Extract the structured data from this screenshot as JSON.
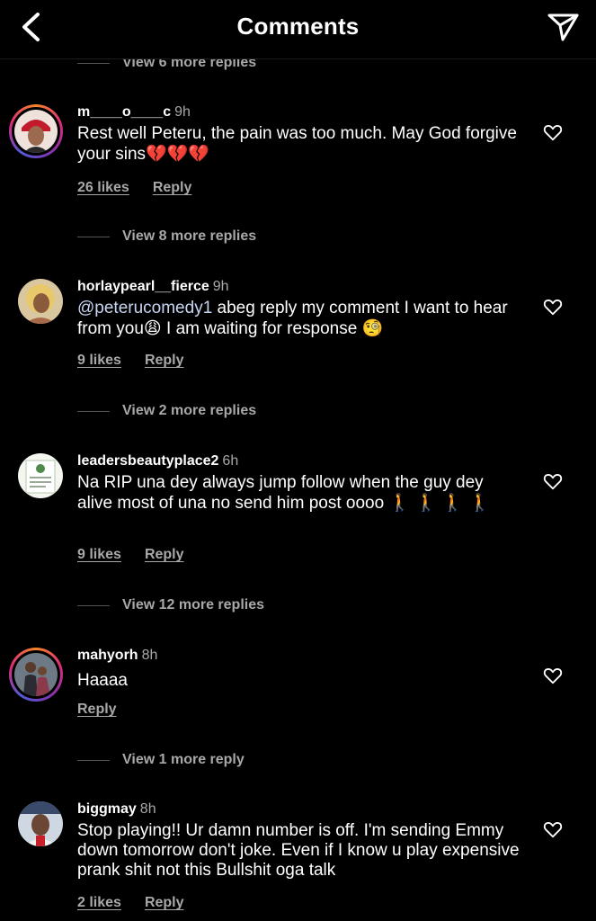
{
  "header": {
    "title": "Comments",
    "back_icon": "chevron-left-icon",
    "share_icon": "paper-plane-icon"
  },
  "view_more_top": "View 6 more replies",
  "comments": [
    {
      "username": "m____o____c",
      "time": "9h",
      "text": "Rest well Peteru, the pain was too much. May God forgive your sins",
      "emojis": "💔💔💔",
      "likes": "26 likes",
      "reply": "Reply",
      "view_more": "View 8 more replies"
    },
    {
      "username": "horlaypearl__fierce",
      "time": "9h",
      "mention": "@peterucomedy1",
      "text_a": " abeg reply my comment I want to hear from you",
      "emoji_a": "😩",
      "text_b": " I am waiting for response ",
      "emoji_b": "🧐",
      "likes": "9 likes",
      "reply": "Reply",
      "view_more": "View 2 more replies"
    },
    {
      "username": "leadersbeautyplace2",
      "time": "6h",
      "text": "Na RIP una dey always jump follow when the guy dey alive most of una no send him post oooo",
      "emojis": "🚶 🚶 🚶 🚶",
      "likes": "9 likes",
      "reply": "Reply",
      "view_more": "View 12 more replies"
    },
    {
      "username": "mahyorh",
      "time": "8h",
      "text": "Haaaa",
      "reply": "Reply",
      "view_more": "View 1 more reply"
    },
    {
      "username": "biggmay",
      "time": "8h",
      "text": "Stop playing!! Ur damn number is off. I'm sending Emmy down tomorrow don't joke. Even if I know u play expensive prank shit not this Bullshit oga talk",
      "likes": "2 likes",
      "reply": "Reply"
    }
  ],
  "colors": {
    "background": "#000000",
    "secondary_text": "#a8a8a8",
    "mention": "#c7d6f0"
  }
}
